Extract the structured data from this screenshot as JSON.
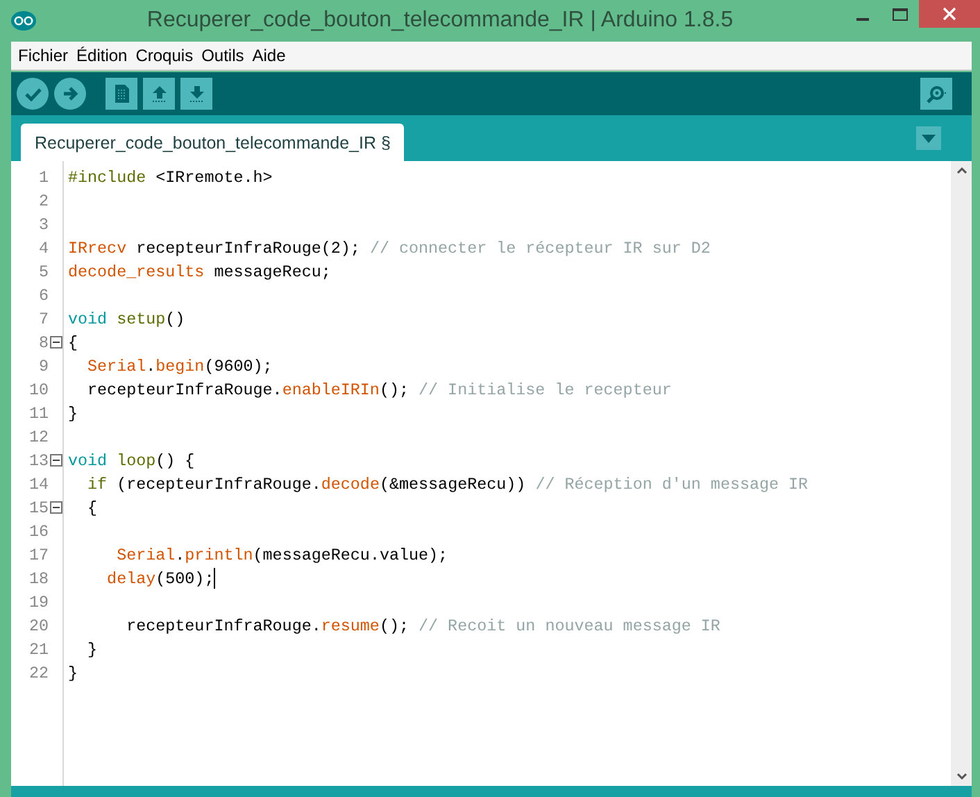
{
  "window": {
    "title": "Recuperer_code_bouton_telecommande_IR | Arduino 1.8.5"
  },
  "menu": [
    "Fichier",
    "Édition",
    "Croquis",
    "Outils",
    "Aide"
  ],
  "toolbar": [
    {
      "kind": "verify"
    },
    {
      "kind": "upload"
    },
    {
      "kind": "new"
    },
    {
      "kind": "open"
    },
    {
      "kind": "save"
    }
  ],
  "toolbar_right": [
    {
      "kind": "serial-monitor"
    }
  ],
  "tabs": [
    {
      "label": "Recuperer_code_bouton_telecommande_IR §",
      "selected": true
    }
  ],
  "editor": {
    "lines": [
      {
        "number": "1",
        "fold": false,
        "cursor": false,
        "tokens": [
          {
            "text": "#include",
            "kind": "directive"
          },
          {
            "text": " <IRremote.h>",
            "kind": "plain"
          }
        ]
      },
      {
        "number": "2",
        "fold": false,
        "cursor": false
      },
      {
        "number": "3",
        "fold": false,
        "cursor": false
      },
      {
        "number": "4",
        "fold": false,
        "cursor": false,
        "tokens": [
          {
            "text": "IRrecv",
            "kind": "type"
          },
          {
            "text": " recepteurInfraRouge(2); ",
            "kind": "plain"
          },
          {
            "text": "// connecter le récepteur IR sur D2",
            "kind": "comment"
          }
        ]
      },
      {
        "number": "5",
        "fold": false,
        "cursor": false,
        "tokens": [
          {
            "text": "decode_results",
            "kind": "type"
          },
          {
            "text": " messageRecu;",
            "kind": "plain"
          }
        ]
      },
      {
        "number": "6",
        "fold": false,
        "cursor": false
      },
      {
        "number": "7",
        "fold": false,
        "cursor": false,
        "tokens": [
          {
            "text": "void",
            "kind": "keyword"
          },
          {
            "text": " setup",
            "kind": "control"
          },
          {
            "text": "()",
            "kind": "plain"
          }
        ]
      },
      {
        "number": "8",
        "fold": true,
        "cursor": false,
        "tokens": [
          {
            "text": "{",
            "kind": "plain"
          }
        ]
      },
      {
        "number": "9",
        "fold": false,
        "cursor": false,
        "tokens": [
          {
            "text": "  Serial",
            "kind": "type"
          },
          {
            "text": ".",
            "kind": "plain"
          },
          {
            "text": "begin",
            "kind": "function"
          },
          {
            "text": "(9600);",
            "kind": "plain"
          }
        ]
      },
      {
        "number": "10",
        "fold": false,
        "cursor": false,
        "tokens": [
          {
            "text": "  recepteurInfraRouge.",
            "kind": "plain"
          },
          {
            "text": "enableIRIn",
            "kind": "function"
          },
          {
            "text": "(); ",
            "kind": "plain"
          },
          {
            "text": "// Initialise le recepteur",
            "kind": "comment"
          }
        ]
      },
      {
        "number": "11",
        "fold": false,
        "cursor": false,
        "tokens": [
          {
            "text": "}",
            "kind": "plain"
          }
        ]
      },
      {
        "number": "12",
        "fold": false,
        "cursor": false
      },
      {
        "number": "13",
        "fold": true,
        "cursor": false,
        "tokens": [
          {
            "text": "void",
            "kind": "keyword"
          },
          {
            "text": " loop",
            "kind": "control"
          },
          {
            "text": "() {",
            "kind": "plain"
          }
        ]
      },
      {
        "number": "14",
        "fold": false,
        "cursor": false,
        "tokens": [
          {
            "text": "  if",
            "kind": "control"
          },
          {
            "text": " (recepteurInfraRouge.",
            "kind": "plain"
          },
          {
            "text": "decode",
            "kind": "function"
          },
          {
            "text": "(&messageRecu)) ",
            "kind": "plain"
          },
          {
            "text": "// Réception d'un message IR",
            "kind": "comment"
          }
        ]
      },
      {
        "number": "15",
        "fold": true,
        "cursor": false,
        "tokens": [
          {
            "text": "  {",
            "kind": "plain"
          }
        ]
      },
      {
        "number": "16",
        "fold": false,
        "cursor": false
      },
      {
        "number": "17",
        "fold": false,
        "cursor": false,
        "tokens": [
          {
            "text": "     Serial",
            "kind": "type"
          },
          {
            "text": ".",
            "kind": "plain"
          },
          {
            "text": "println",
            "kind": "function"
          },
          {
            "text": "(messageRecu.value);",
            "kind": "plain"
          }
        ]
      },
      {
        "number": "18",
        "fold": false,
        "cursor": true,
        "tokens": [
          {
            "text": "    delay",
            "kind": "function"
          },
          {
            "text": "(500);",
            "kind": "plain"
          }
        ]
      },
      {
        "number": "19",
        "fold": false,
        "cursor": false
      },
      {
        "number": "20",
        "fold": false,
        "cursor": false,
        "tokens": [
          {
            "text": "      recepteurInfraRouge.",
            "kind": "plain"
          },
          {
            "text": "resume",
            "kind": "function"
          },
          {
            "text": "(); ",
            "kind": "plain"
          },
          {
            "text": "// Recoit un nouveau message IR",
            "kind": "comment"
          }
        ]
      },
      {
        "number": "21",
        "fold": false,
        "cursor": false,
        "tokens": [
          {
            "text": "  }",
            "kind": "plain"
          }
        ]
      },
      {
        "number": "22",
        "fold": false,
        "cursor": false,
        "tokens": [
          {
            "text": "}",
            "kind": "plain"
          }
        ]
      }
    ]
  }
}
